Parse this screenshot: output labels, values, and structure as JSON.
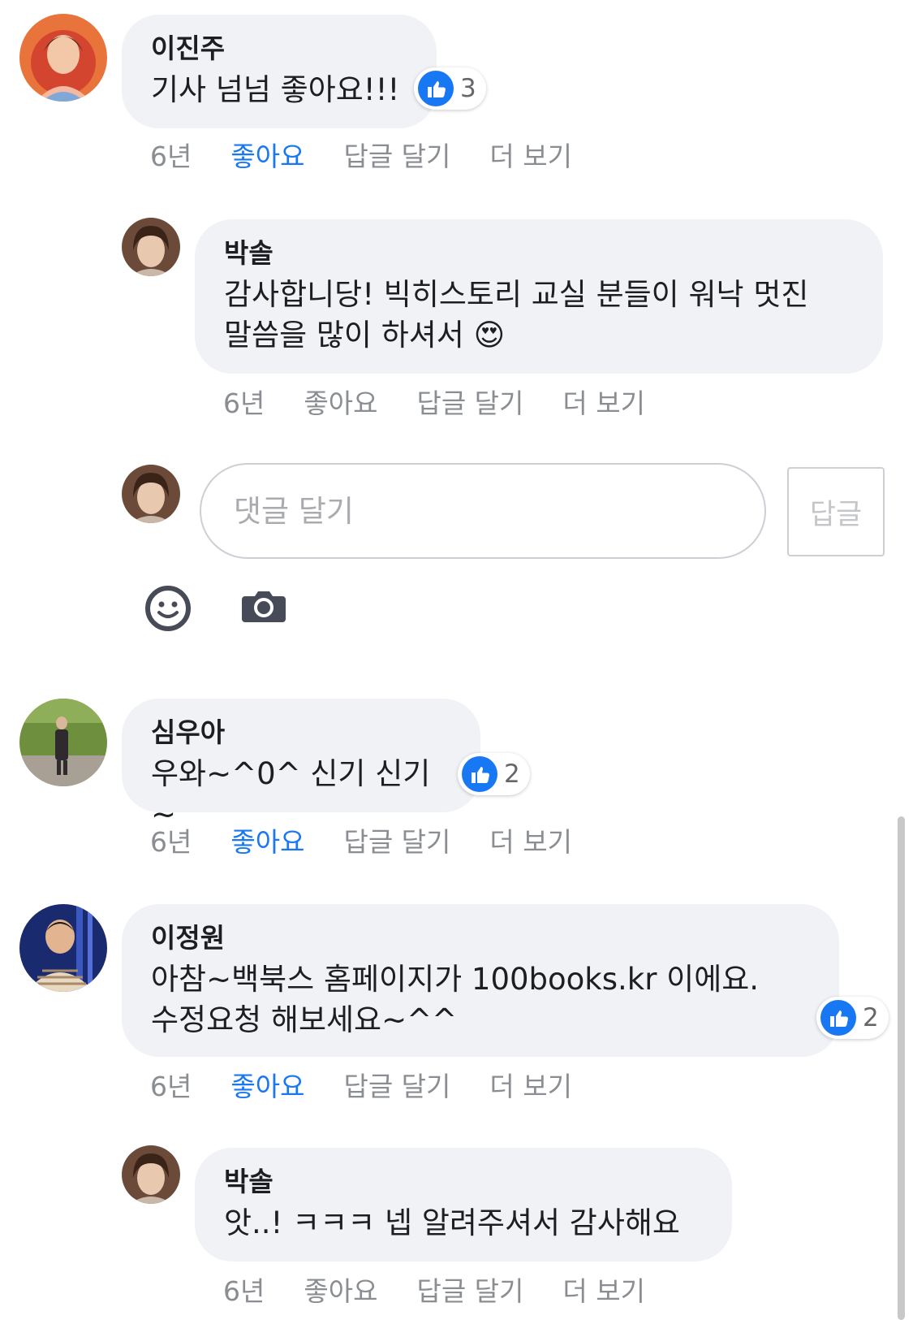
{
  "comments": [
    {
      "author": "이진주",
      "text": "기사 넘넘 좋아요!!!",
      "likes": "3",
      "time": "6년",
      "like_label": "좋아요",
      "reply_label": "답글 달기",
      "more_label": "더 보기",
      "liked": true
    },
    {
      "author": "박솔",
      "text": "감사합니당! 빅히스토리 교실 분들이 워낙 멋진\n말씀을 많이 하셔서 😍",
      "time": "6년",
      "like_label": "좋아요",
      "reply_label": "답글 달기",
      "more_label": "더 보기",
      "liked": false
    },
    {
      "author": "심우아",
      "text": "우와~^0^ 신기 신기~",
      "likes": "2",
      "time": "6년",
      "like_label": "좋아요",
      "reply_label": "답글 달기",
      "more_label": "더 보기",
      "liked": true
    },
    {
      "author": "이정원",
      "text": "아참~백북스 홈페이지가 100books.kr 이에요.\n수정요청 해보세요~^^",
      "likes": "2",
      "time": "6년",
      "like_label": "좋아요",
      "reply_label": "답글 달기",
      "more_label": "더 보기",
      "liked": true
    },
    {
      "author": "박솔",
      "text": "앗..! ㅋㅋㅋ 넵 알려주셔서 감사해요",
      "time": "6년",
      "like_label": "좋아요",
      "reply_label": "답글 달기",
      "more_label": "더 보기",
      "liked": false
    }
  ],
  "reply_input": {
    "placeholder": "댓글 달기",
    "submit_label": "답글"
  },
  "icons": {
    "emoji": "smiley-icon",
    "camera": "camera-icon",
    "like": "thumbs-up-icon"
  },
  "colors": {
    "accent": "#1877f2",
    "bubble": "#f0f2f5",
    "muted": "#8a8d91"
  }
}
